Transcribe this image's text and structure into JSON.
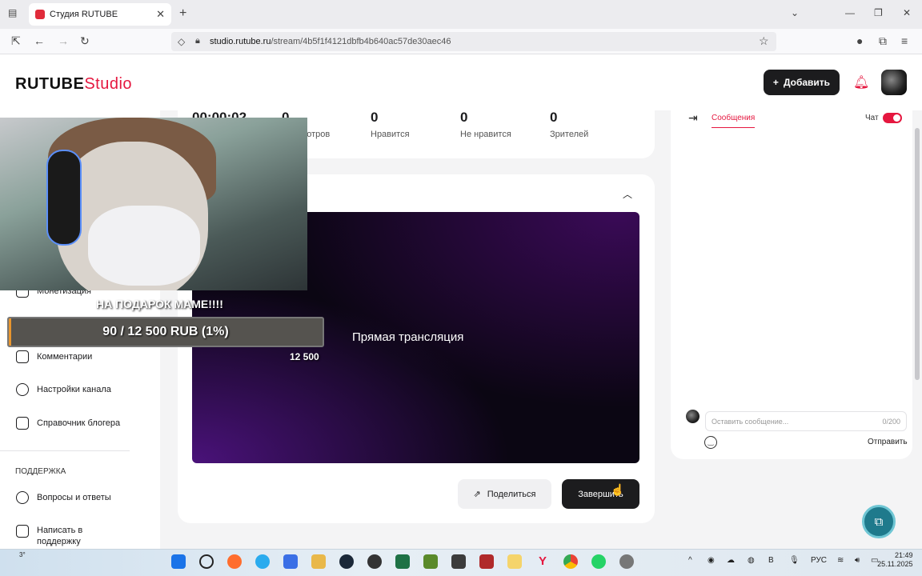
{
  "browser": {
    "tab_title": "Студия RUTUBE",
    "url_domain": "studio.rutube.ru",
    "url_path": "/stream/4b5f1f4121dbfb4b640ac57de30aec46"
  },
  "header": {
    "logo_main": "RUTUBE",
    "logo_studio": "Studio",
    "add_button": "Добавить"
  },
  "sidebar": {
    "items": [
      {
        "label": "Монетизация"
      },
      {
        "label": "Комментарии"
      },
      {
        "label": "Настройки канала"
      },
      {
        "label": "Справочник блогера"
      }
    ],
    "section_title": "ПОДДЕРЖКА",
    "support_items": [
      {
        "label": "Вопросы и ответы"
      },
      {
        "label": "Написать в поддержку"
      }
    ]
  },
  "stats": {
    "timer": "00:00:02",
    "views_value": "0",
    "views_label": "просмотров",
    "likes_value": "0",
    "likes_label": "Нравится",
    "dislikes_value": "0",
    "dislikes_label": "Не нравится",
    "viewers_value": "0",
    "viewers_label": "Зрителей"
  },
  "player": {
    "title": "Прямая трансляция"
  },
  "actions": {
    "share": "Поделиться",
    "end": "Завершить"
  },
  "chat": {
    "tab_messages": "Сообщения",
    "toggle_label": "Чат",
    "toggle_on": true,
    "input_placeholder": "Оставить сообщение...",
    "char_count": "0/200",
    "send": "Отправить"
  },
  "donation": {
    "title": "НА ПОДАРОК МАМЕ!!!!",
    "progress_text": "90 / 12 500 RUB (1%)",
    "progress_fraction": 0.0072,
    "goal": "12 500",
    "fill_color": "#e9962e"
  },
  "taskbar": {
    "weather": "3°",
    "lang": "РУС",
    "time": "21:49",
    "date": "25.11.2025"
  },
  "colors": {
    "accent": "#e5173f",
    "dark_button": "#1c1c1e"
  }
}
